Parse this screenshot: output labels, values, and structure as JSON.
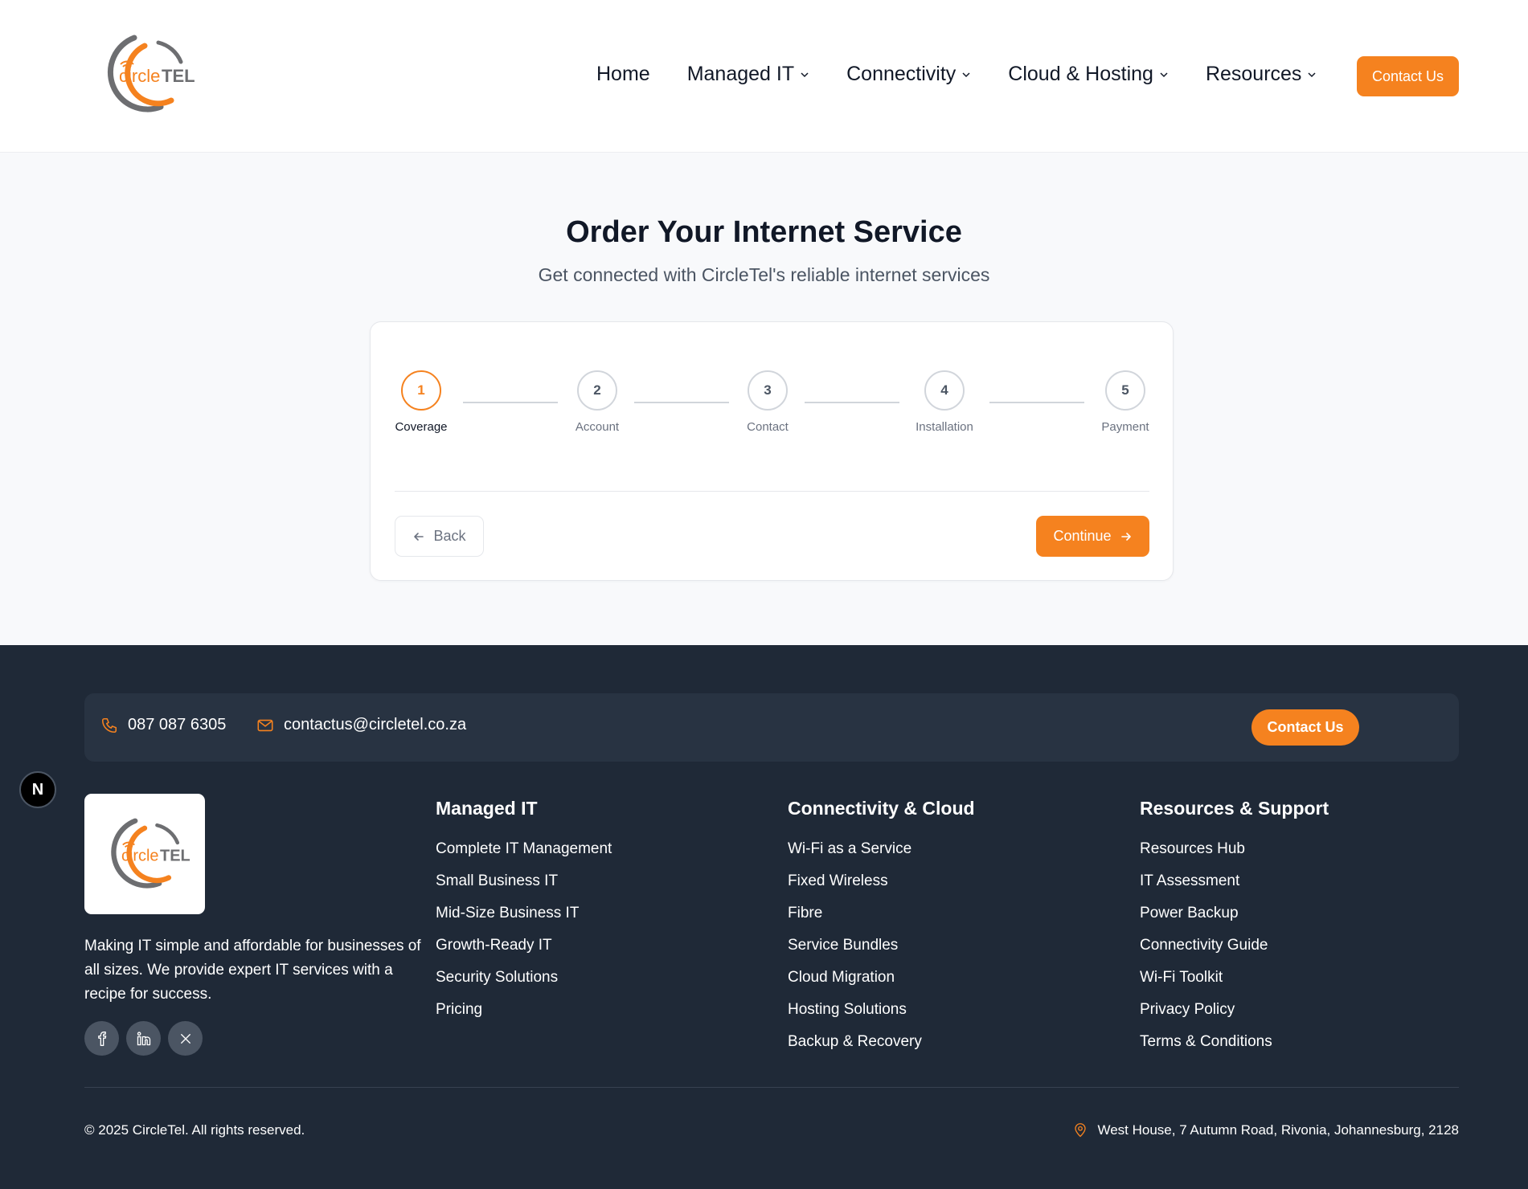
{
  "brand": {
    "logo_main": "circle",
    "logo_accent": "TEL",
    "colors": {
      "accent": "#f5821f",
      "gray": "#6d6e71",
      "footer_bg": "#1f2937"
    }
  },
  "nav": {
    "items": [
      {
        "label": "Home",
        "dropdown": false
      },
      {
        "label": "Managed IT",
        "dropdown": true
      },
      {
        "label": "Connectivity",
        "dropdown": true
      },
      {
        "label": "Cloud & Hosting",
        "dropdown": true
      },
      {
        "label": "Resources",
        "dropdown": true
      }
    ],
    "contact_label": "Contact Us"
  },
  "main": {
    "title": "Order Your Internet Service",
    "subtitle": "Get connected with CircleTel's reliable internet services"
  },
  "stepper": {
    "current_step": 1,
    "steps": [
      {
        "number": "1",
        "label": "Coverage"
      },
      {
        "number": "2",
        "label": "Account"
      },
      {
        "number": "3",
        "label": "Contact"
      },
      {
        "number": "4",
        "label": "Installation"
      },
      {
        "number": "5",
        "label": "Payment"
      }
    ],
    "back_label": "Back",
    "continue_label": "Continue"
  },
  "footer": {
    "phone": "087 087 6305",
    "email": "contactus@circletel.co.za",
    "contact_label": "Contact Us",
    "badge_letter": "N",
    "description": "Making IT simple and affordable for businesses of all sizes. We provide expert IT services with a recipe for success.",
    "socials": [
      "facebook-icon",
      "linkedin-icon",
      "x-icon"
    ],
    "columns": [
      {
        "title": "Managed IT",
        "links": [
          "Complete IT Management",
          "Small Business IT",
          "Mid-Size Business IT",
          "Growth-Ready IT",
          "Security Solutions",
          "Pricing"
        ]
      },
      {
        "title": "Connectivity & Cloud",
        "links": [
          "Wi-Fi as a Service",
          "Fixed Wireless",
          "Fibre",
          "Service Bundles",
          "Cloud Migration",
          "Hosting Solutions",
          "Backup & Recovery"
        ]
      },
      {
        "title": "Resources & Support",
        "links": [
          "Resources Hub",
          "IT Assessment",
          "Power Backup",
          "Connectivity Guide",
          "Wi-Fi Toolkit",
          "Privacy Policy",
          "Terms & Conditions"
        ]
      }
    ],
    "copyright": "© 2025 CircleTel. All rights reserved.",
    "address": "West House, 7 Autumn Road, Rivonia, Johannesburg, 2128"
  }
}
